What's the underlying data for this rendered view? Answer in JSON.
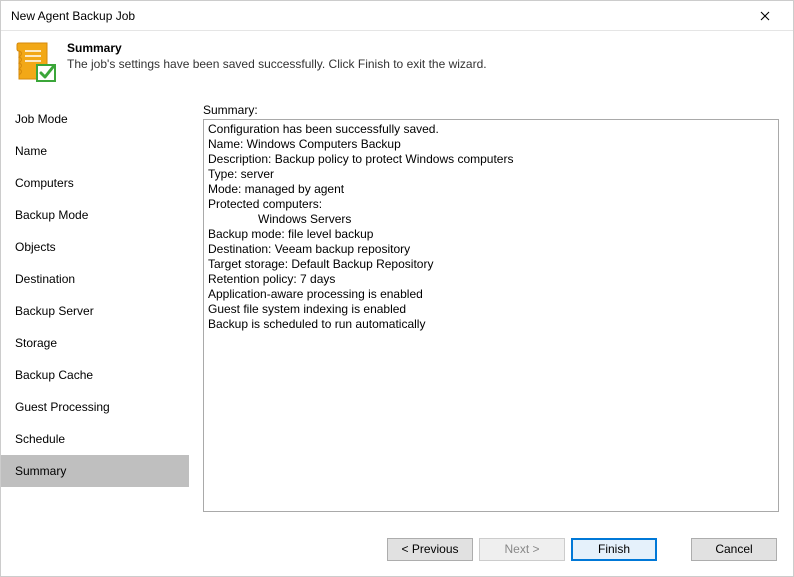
{
  "window": {
    "title": "New Agent Backup Job"
  },
  "header": {
    "title": "Summary",
    "subtitle": "The job's settings have been saved successfully. Click Finish to exit the wizard."
  },
  "sidebar": {
    "items": [
      {
        "label": "Job Mode"
      },
      {
        "label": "Name"
      },
      {
        "label": "Computers"
      },
      {
        "label": "Backup Mode"
      },
      {
        "label": "Objects"
      },
      {
        "label": "Destination"
      },
      {
        "label": "Backup Server"
      },
      {
        "label": "Storage"
      },
      {
        "label": "Backup Cache"
      },
      {
        "label": "Guest Processing"
      },
      {
        "label": "Schedule"
      },
      {
        "label": "Summary"
      }
    ]
  },
  "main": {
    "summary_label": "Summary:",
    "summary_text": "Configuration has been successfully saved.\nName: Windows Computers Backup\nDescription: Backup policy to protect Windows computers\nType: server\nMode: managed by agent\nProtected computers:\n               Windows Servers\nBackup mode: file level backup\nDestination: Veeam backup repository\nTarget storage: Default Backup Repository\nRetention policy: 7 days\nApplication-aware processing is enabled\nGuest file system indexing is enabled\nBackup is scheduled to run automatically"
  },
  "footer": {
    "previous": "< Previous",
    "next": "Next >",
    "finish": "Finish",
    "cancel": "Cancel"
  }
}
